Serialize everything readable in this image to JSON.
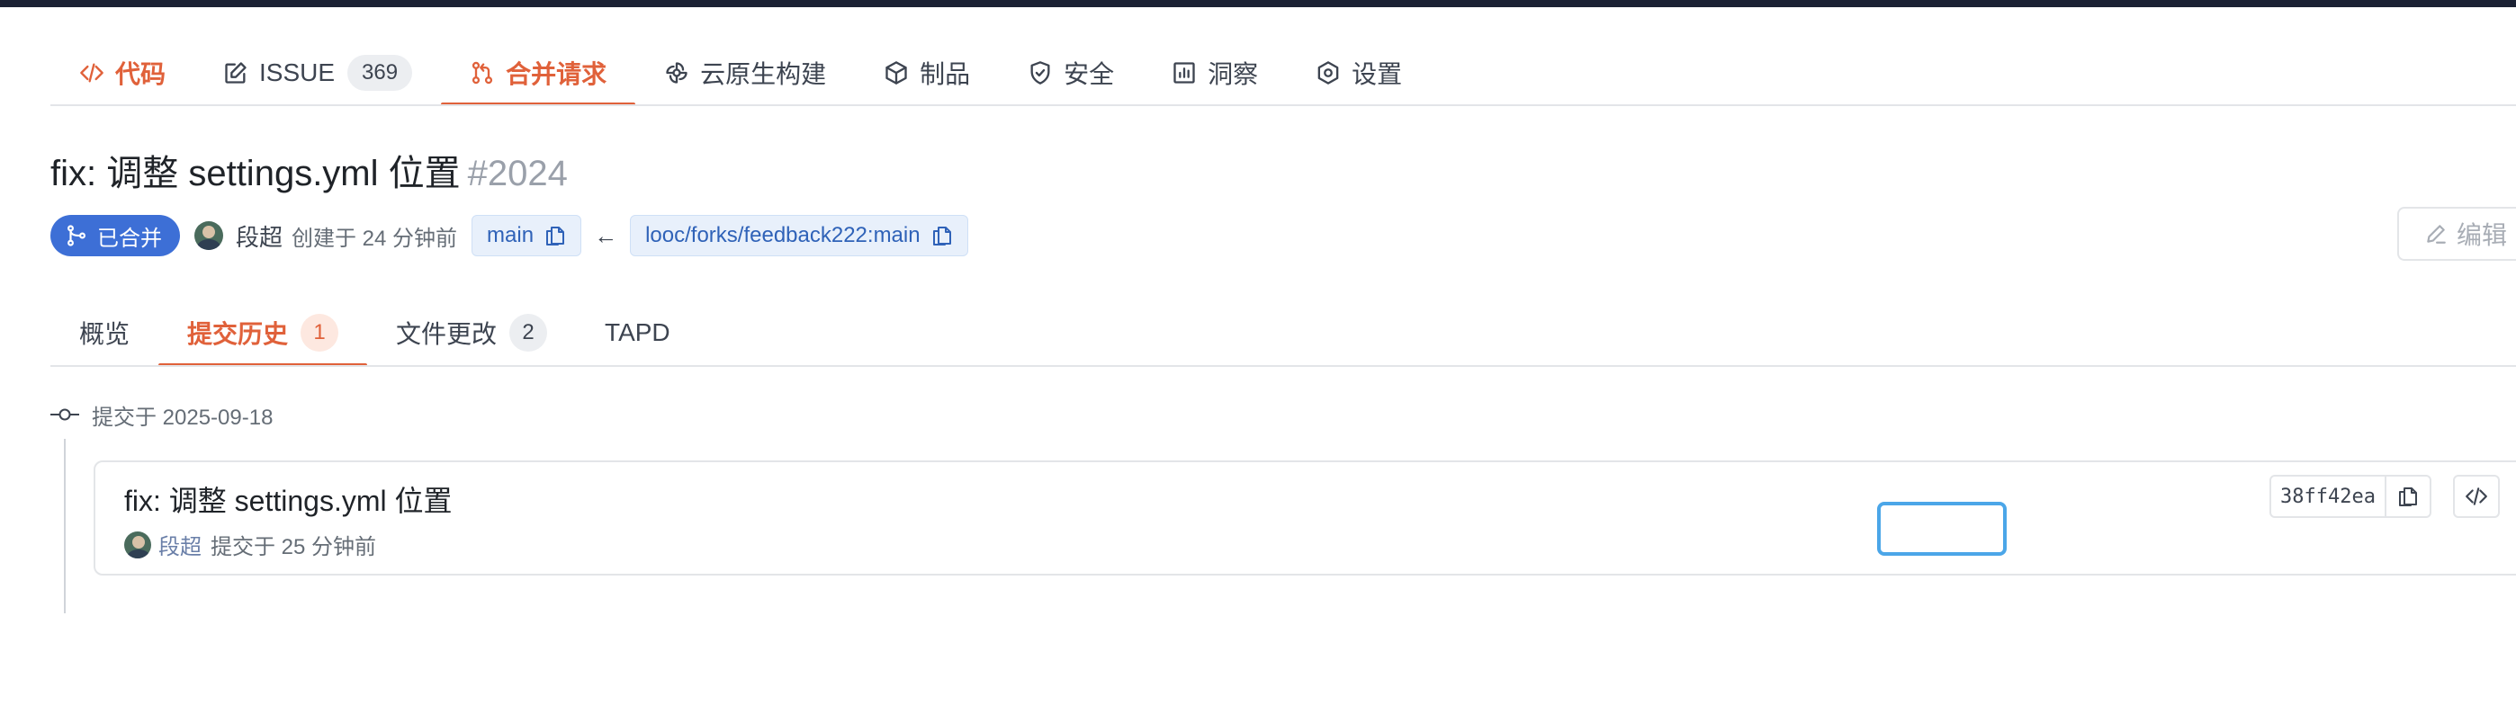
{
  "repo_tabs": {
    "code": "代码",
    "issue": "ISSUE",
    "issue_count": "369",
    "pr": "合并请求",
    "cloud_build": "云原生构建",
    "artifacts": "制品",
    "security": "安全",
    "insights": "洞察",
    "settings": "设置"
  },
  "pr": {
    "title": "fix: 调整 settings.yml 位置",
    "number": "#2024",
    "status": "已合并",
    "author": "段超",
    "created": "创建于 24 分钟前",
    "target_branch": "main",
    "arrow": "←",
    "source_branch": "looc/forks/feedback222:main",
    "edit_label": "编辑"
  },
  "pr_tabs": {
    "overview": "概览",
    "commits": "提交历史",
    "commits_count": "1",
    "files": "文件更改",
    "files_count": "2",
    "tapd": "TAPD"
  },
  "commits": {
    "date_label": "提交于 2025-09-18",
    "message": "fix: 调整 settings.yml 位置",
    "author": "段超",
    "time": "提交于 25 分钟前",
    "sha": "38ff42ea"
  },
  "colors": {
    "accent": "#e0613a",
    "merged": "#3d6fd6",
    "branch_text": "#2f62b8",
    "focus": "#4ba6e8"
  }
}
